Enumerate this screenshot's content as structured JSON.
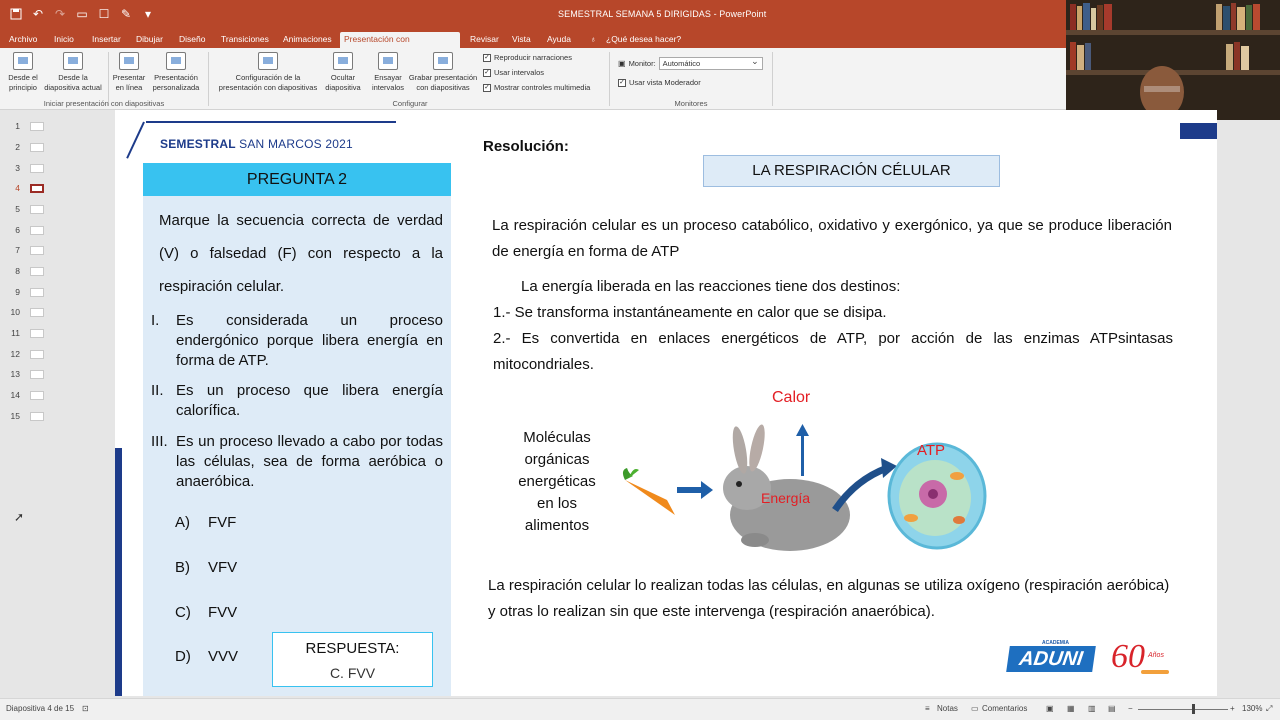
{
  "window": {
    "title": "SEMESTRAL SEMANA 5 DIRIGIDAS  -  PowerPoint"
  },
  "tabs": [
    "Archivo",
    "Inicio",
    "Insertar",
    "Dibujar",
    "Diseño",
    "Transiciones",
    "Animaciones",
    "Presentación con diapositivas",
    "Revisar",
    "Vista",
    "Ayuda",
    "¿Qué desea hacer?"
  ],
  "ribbon": {
    "desde_principio": [
      "Desde el",
      "principio"
    ],
    "desde_actual": [
      "Desde la",
      "diapositiva actual"
    ],
    "presentar_linea": [
      "Presentar",
      "en línea"
    ],
    "presentacion_personalizada": [
      "Presentación",
      "personalizada"
    ],
    "configuracion": [
      "Configuración de la",
      "presentación con diapositivas"
    ],
    "ocultar": [
      "Ocultar",
      "diapositiva"
    ],
    "ensayar": [
      "Ensayar",
      "intervalos"
    ],
    "grabar": [
      "Grabar presentación",
      "con diapositivas"
    ],
    "chk_narraciones": "Reproducir narraciones",
    "chk_intervalos": "Usar intervalos",
    "chk_controles": "Mostrar controles multimedia",
    "monitor_label": "Monitor:",
    "monitor_value": "Automático",
    "chk_moderador": "Usar vista Moderador",
    "group_iniciar": "Iniciar presentación con diapositivas",
    "group_configurar": "Configurar",
    "group_monitores": "Monitores"
  },
  "thumbnails": [
    "1",
    "2",
    "3",
    "4",
    "5",
    "6",
    "7",
    "8",
    "9",
    "10",
    "11",
    "12",
    "13",
    "14",
    "15"
  ],
  "slide": {
    "brand_bold": "SEMESTRAL",
    "brand_rest": "SAN MARCOS 2021",
    "pregunta": "PREGUNTA 2",
    "question": "Marque la secuencia correcta de verdad (V) o falsedad (F) con respecto a la respiración celular.",
    "statements": [
      {
        "rn": "I.",
        "text": "Es considerada un proceso endergónico porque libera energía en forma de ATP."
      },
      {
        "rn": "II.",
        "text": "Es un proceso que libera energía calorífica."
      },
      {
        "rn": "III.",
        "text": "Es un proceso llevado a cabo por todas las células, sea de forma aeróbica o anaeróbica."
      }
    ],
    "options": [
      {
        "letter": "A)",
        "value": "FVF"
      },
      {
        "letter": "B)",
        "value": "VFV"
      },
      {
        "letter": "C)",
        "value": "FVV"
      },
      {
        "letter": "D)",
        "value": "VVV"
      }
    ],
    "answer_label": "RESPUESTA:",
    "answer_value": "C. FVV",
    "resolucion": "Resolución:",
    "resp_title": "LA RESPIRACIÓN CÉLULAR",
    "para1": "La respiración celular es un proceso catabólico, oxidativo y exergónico, ya que se produce liberación de energía en forma de ATP",
    "para2_line1": "La energía liberada en las reacciones tiene dos destinos:",
    "para2_line2": "1.- Se transforma instantáneamente en calor que se disipa.",
    "para2_line3": "2.- Es convertida en enlaces energéticos de ATP, por acción  de las enzimas ATPsintasas mitocondriales.",
    "diagram": {
      "moleculas": [
        "Moléculas",
        "orgánicas",
        "energéticas",
        "en los",
        "alimentos"
      ],
      "calor": "Calor",
      "energia": "Energía",
      "atp": "ATP"
    },
    "para3": "La respiración celular lo realizan todas las células, en algunas se utiliza oxígeno (respiración aeróbica) y otras lo realizan sin que este intervenga (respiración anaeróbica).",
    "logo_academia": "ACADEMIA",
    "logo_aduni": "ADUNI",
    "logo_60": "60",
    "logo_anos": "Años"
  },
  "status": {
    "slide_count": "Diapositiva 4 de 15",
    "notas": "Notas",
    "comentarios": "Comentarios",
    "zoom": "130%"
  },
  "colors": {
    "titlebar": "#b7472a",
    "accent_blue": "#1d3b8a",
    "cyan": "#38c2f0",
    "panel": "#deebf7"
  }
}
